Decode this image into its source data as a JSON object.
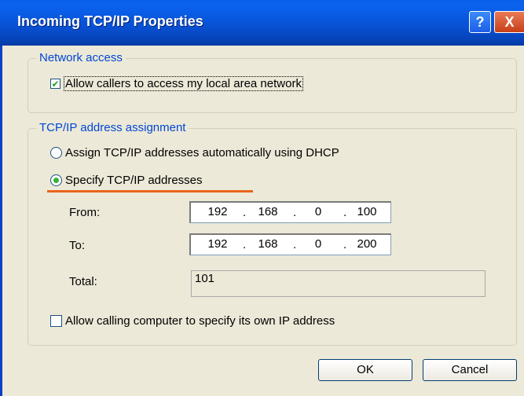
{
  "window": {
    "title": "Incoming TCP/IP Properties",
    "help_symbol": "?",
    "close_symbol": "X"
  },
  "network_access": {
    "legend": "Network access",
    "allow_callers_label": "Allow callers to access my local area network",
    "allow_callers_checked": true
  },
  "tcpip": {
    "legend": "TCP/IP address assignment",
    "dhcp_option_label": "Assign TCP/IP addresses automatically using DHCP",
    "specify_option_label": "Specify TCP/IP addresses",
    "selected_option": "specify",
    "from_label": "From:",
    "from_octets": [
      "192",
      "168",
      "0",
      "100"
    ],
    "to_label": "To:",
    "to_octets": [
      "192",
      "168",
      "0",
      "200"
    ],
    "total_label": "Total:",
    "total_value": "101",
    "allow_specify_label": "Allow calling computer to specify its own IP address",
    "allow_specify_checked": false
  },
  "buttons": {
    "ok_label": "OK",
    "cancel_label": "Cancel"
  },
  "colors": {
    "title_bar": "#0852d6",
    "legend_text": "#0046d5",
    "annotation_underline": "#e8641c"
  }
}
